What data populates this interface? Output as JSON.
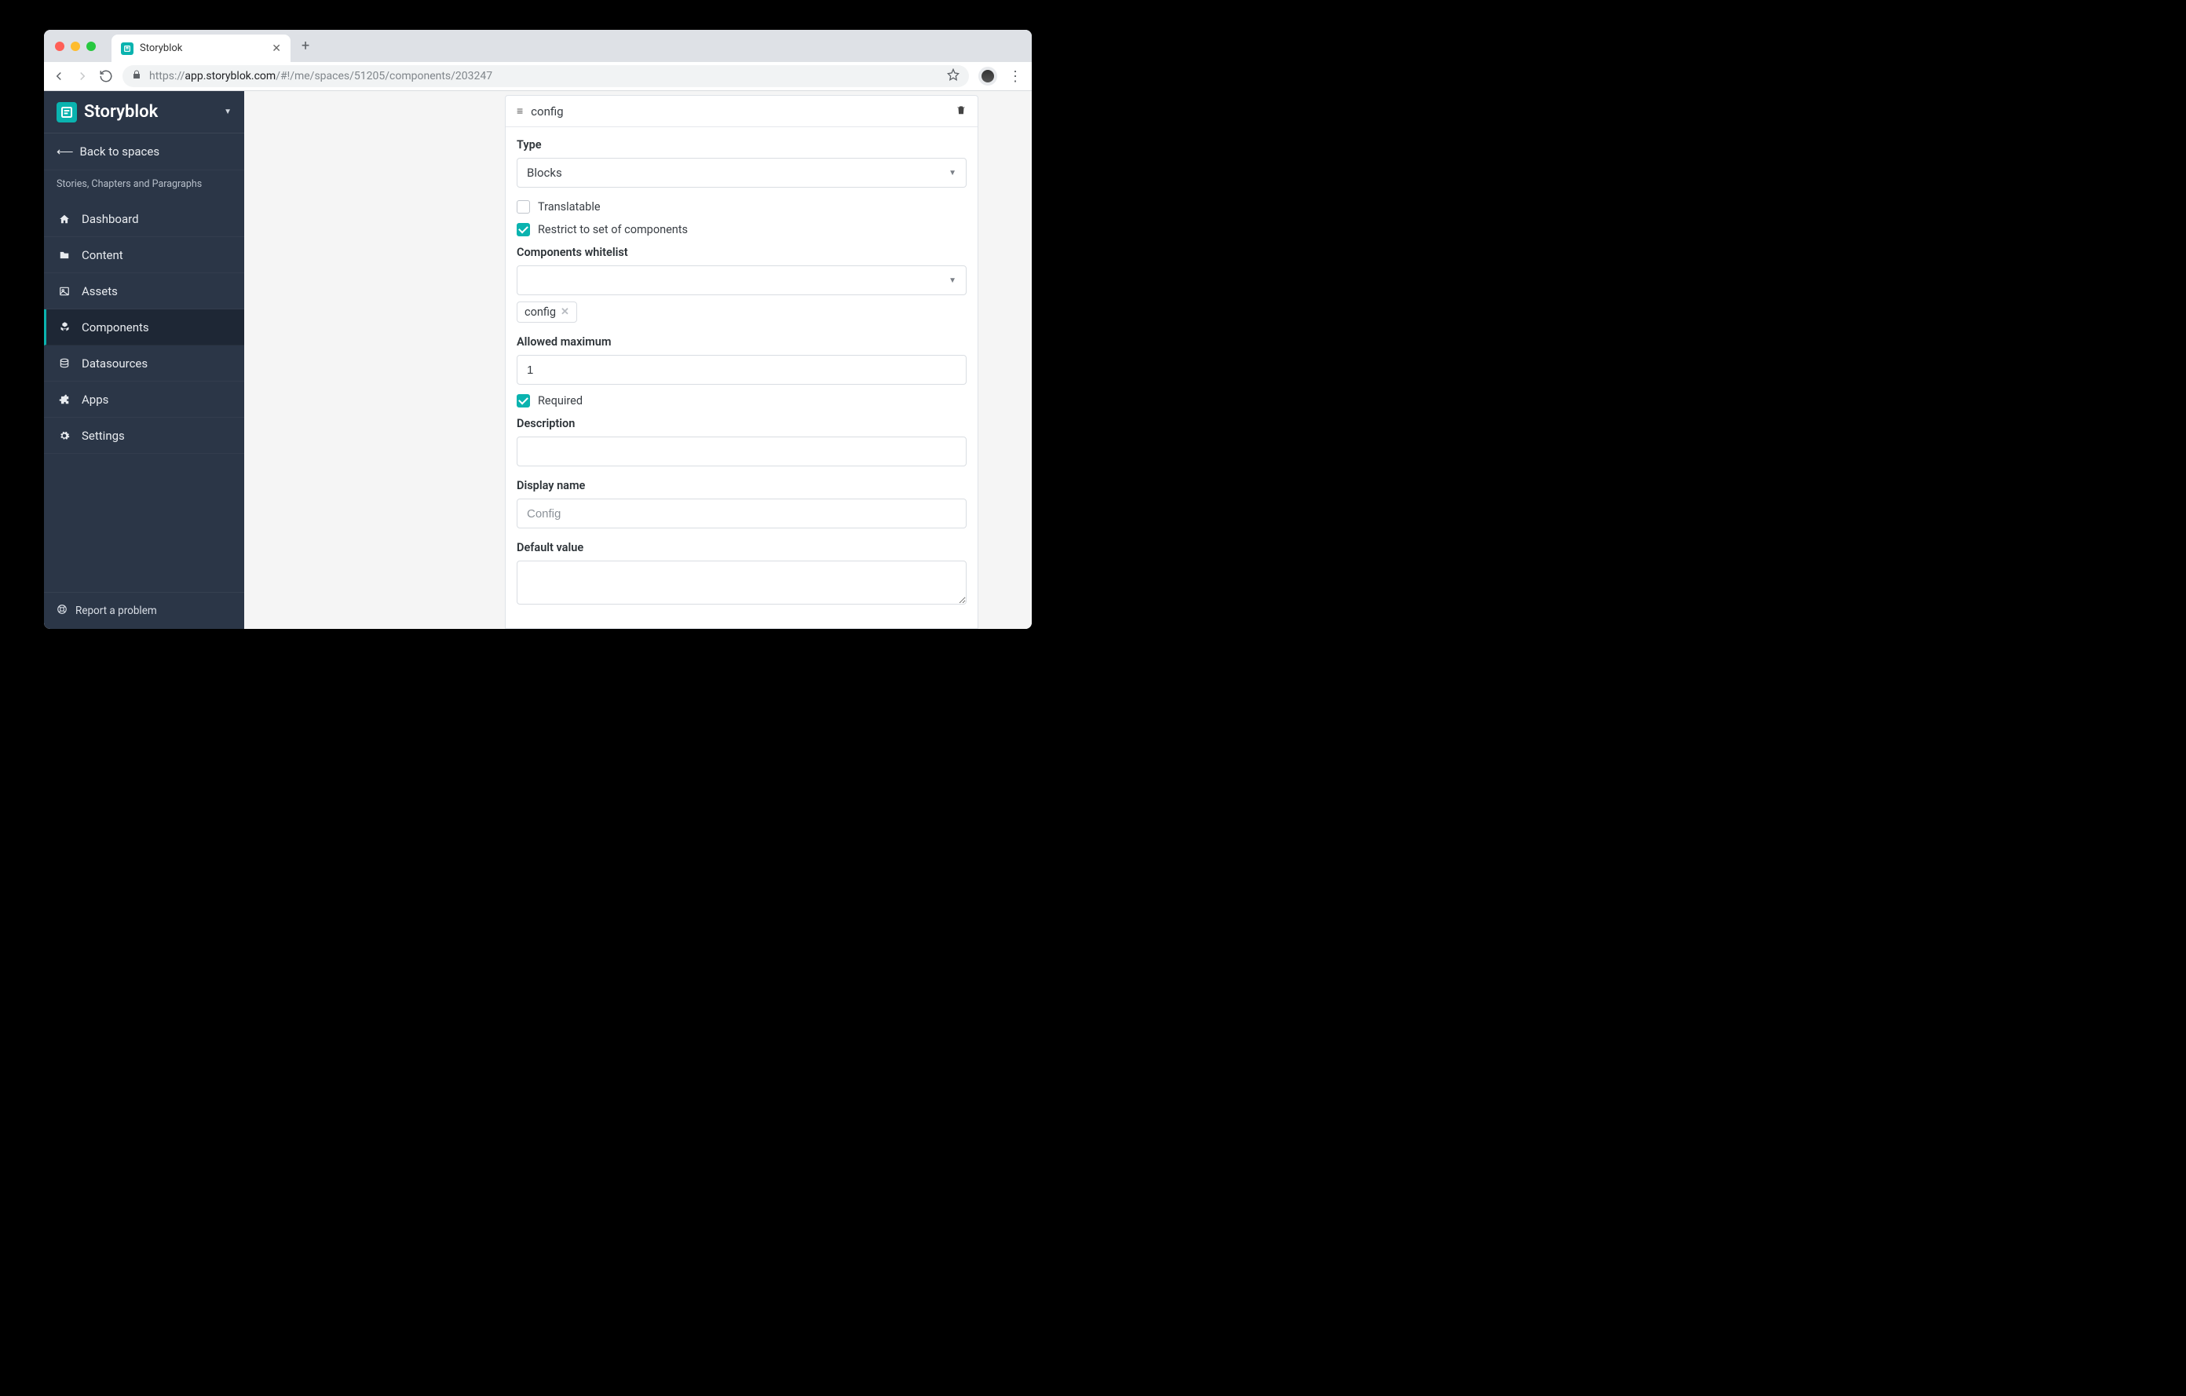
{
  "browser": {
    "tab_title": "Storyblok",
    "url_proto": "https://",
    "url_host": "app.storyblok.com",
    "url_path": "/#!/me/spaces/51205/components/203247"
  },
  "sidebar": {
    "brand": "Storyblok",
    "back": "Back to spaces",
    "space_name": "Stories, Chapters and Paragraphs",
    "items": [
      {
        "label": "Dashboard"
      },
      {
        "label": "Content"
      },
      {
        "label": "Assets"
      },
      {
        "label": "Components"
      },
      {
        "label": "Datasources"
      },
      {
        "label": "Apps"
      },
      {
        "label": "Settings"
      }
    ],
    "report": "Report a problem"
  },
  "panel": {
    "title": "config",
    "type_label": "Type",
    "type_value": "Blocks",
    "translatable_label": "Translatable",
    "restrict_label": "Restrict to set of components",
    "whitelist_label": "Components whitelist",
    "whitelist_chip": "config",
    "max_label": "Allowed maximum",
    "max_value": "1",
    "required_label": "Required",
    "description_label": "Description",
    "description_value": "",
    "display_label": "Display name",
    "display_placeholder": "Config",
    "default_label": "Default value",
    "default_value": ""
  }
}
